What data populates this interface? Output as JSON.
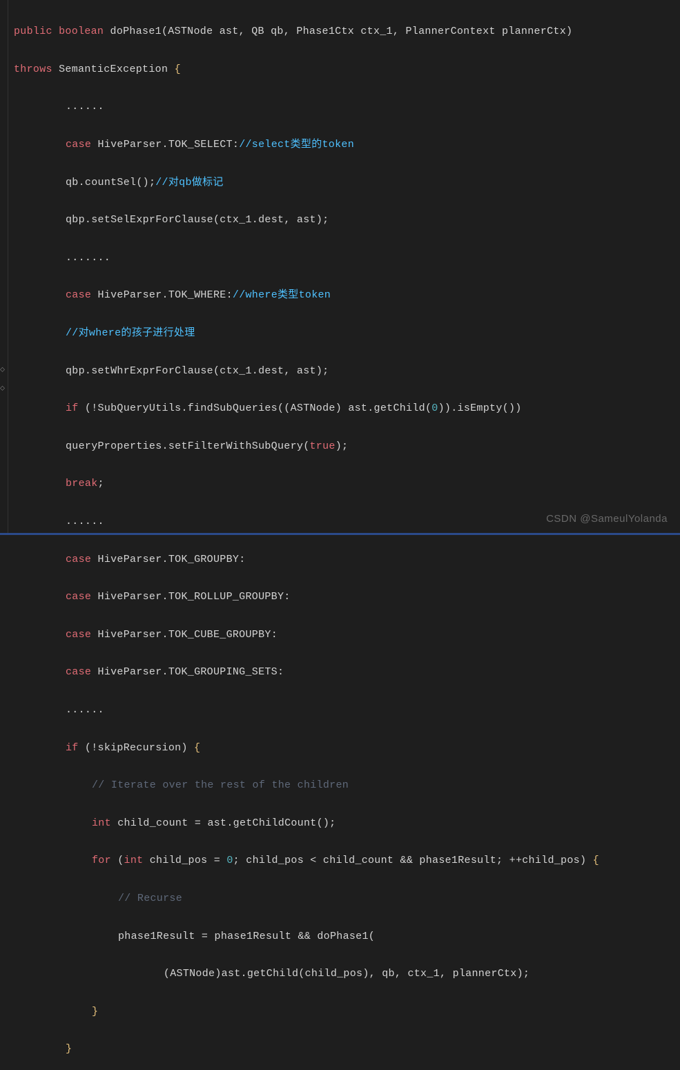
{
  "code": {
    "l1_public": "public",
    "l1_boolean": " boolean ",
    "l1_method": "doPhase1",
    "l1_p1": "(",
    "l1_t1": "ASTNode ",
    "l1_a1": "ast",
    "l1_c1": ", ",
    "l1_t2": "QB ",
    "l1_a2": "qb",
    "l1_c2": ", ",
    "l1_t3": "Phase1Ctx ",
    "l1_a3": "ctx_1",
    "l1_c3": ", ",
    "l1_t4": "PlannerContext ",
    "l1_a4": "plannerCtx",
    "l1_p2": ")",
    "l2_throws": "throws ",
    "l2_exc": "SemanticException ",
    "l2_brace": "{",
    "l3_dots": "......",
    "l4_case": "case",
    "l4_hp": " HiveParser",
    "l4_dot": ".",
    "l4_tok": "TOK_SELECT",
    "l4_colon": ":",
    "l4_comment": "//select类型的token",
    "l5_qb": "qb",
    "l5_dot": ".",
    "l5_call": "countSel",
    "l5_paren": "();",
    "l5_comment": "//对qb做标记",
    "l6_qbp": "qbp",
    "l6_dot": ".",
    "l6_call": "setSelExprForClause",
    "l6_p1": "(",
    "l6_ctx": "ctx_1",
    "l6_dot2": ".",
    "l6_dest": "dest",
    "l6_c": ", ",
    "l6_ast": "ast",
    "l6_p2": ");",
    "l7_dots": ".......",
    "l8_case": "case",
    "l8_hp": " HiveParser",
    "l8_dot": ".",
    "l8_tok": "TOK_WHERE",
    "l8_colon": ":",
    "l8_comment": "//where类型token",
    "l9_comment": "//对where的孩子进行处理",
    "l10_qbp": "qbp",
    "l10_dot": ".",
    "l10_call": "setWhrExprForClause",
    "l10_p1": "(",
    "l10_ctx": "ctx_1",
    "l10_dot2": ".",
    "l10_dest": "dest",
    "l10_c": ", ",
    "l10_ast": "ast",
    "l10_p2": ");",
    "l11_if": "if",
    "l11_p1": " (!",
    "l11_squ": "SubQueryUtils",
    "l11_dot": ".",
    "l11_call": "findSubQueries",
    "l11_p2": "((",
    "l11_type": "ASTNode",
    "l11_p3": ") ",
    "l11_ast": "ast",
    "l11_dot2": ".",
    "l11_gc": "getChild",
    "l11_p4": "(",
    "l11_num": "0",
    "l11_p5": "))",
    "l11_dot3": ".",
    "l11_ie": "isEmpty",
    "l11_p6": "())",
    "l12_qp": "queryProperties",
    "l12_dot": ".",
    "l12_call": "setFilterWithSubQuery",
    "l12_p1": "(",
    "l12_true": "true",
    "l12_p2": ");",
    "l13_break": "break",
    "l13_semi": ";",
    "l14_dots": "......",
    "l15_case": "case",
    "l15_hp": " HiveParser",
    "l15_dot": ".",
    "l15_tok": "TOK_GROUPBY",
    "l15_colon": ":",
    "l16_case": "case",
    "l16_hp": " HiveParser",
    "l16_dot": ".",
    "l16_tok": "TOK_ROLLUP_GROUPBY",
    "l16_colon": ":",
    "l17_case": "case",
    "l17_hp": " HiveParser",
    "l17_dot": ".",
    "l17_tok": "TOK_CUBE_GROUPBY",
    "l17_colon": ":",
    "l18_case": "case",
    "l18_hp": " HiveParser",
    "l18_dot": ".",
    "l18_tok": "TOK_GROUPING_SETS",
    "l18_colon": ":",
    "l19_dots": "......",
    "l20_if": "if",
    "l20_p1": " (!",
    "l20_sr": "skipRecursion",
    "l20_p2": ") ",
    "l20_brace": "{",
    "l21_comment": "// Iterate over the rest of the children",
    "l22_int": "int",
    "l22_var": " child_count ",
    "l22_eq": "= ",
    "l22_ast": "ast",
    "l22_dot": ".",
    "l22_call": "getChildCount",
    "l22_p": "();",
    "l23_for": "for",
    "l23_p1": " (",
    "l23_int": "int",
    "l23_var": " child_pos ",
    "l23_eq": "= ",
    "l23_num": "0",
    "l23_semi": "; ",
    "l23_cond": "child_pos < child_count && phase1Result; ++child_pos",
    "l23_p2": ") ",
    "l23_brace": "{",
    "l24_comment": "// Recurse",
    "l25_pr": "phase1Result ",
    "l25_eq": "= ",
    "l25_pr2": "phase1Result && ",
    "l25_call": "doPhase1",
    "l25_p": "(",
    "l26_p1": "(",
    "l26_type": "ASTNode",
    "l26_p2": ")",
    "l26_ast": "ast",
    "l26_dot": ".",
    "l26_gc": "getChild",
    "l26_p3": "(",
    "l26_cp": "child_pos",
    "l26_p4": "), ",
    "l26_qb": "qb",
    "l26_c1": ", ",
    "l26_ctx": "ctx_1",
    "l26_c2": ", ",
    "l26_pc": "plannerCtx",
    "l26_p5": ");",
    "l27_brace": "}",
    "l28_brace": "}"
  },
  "watermark": "CSDN @SameulYolanda"
}
